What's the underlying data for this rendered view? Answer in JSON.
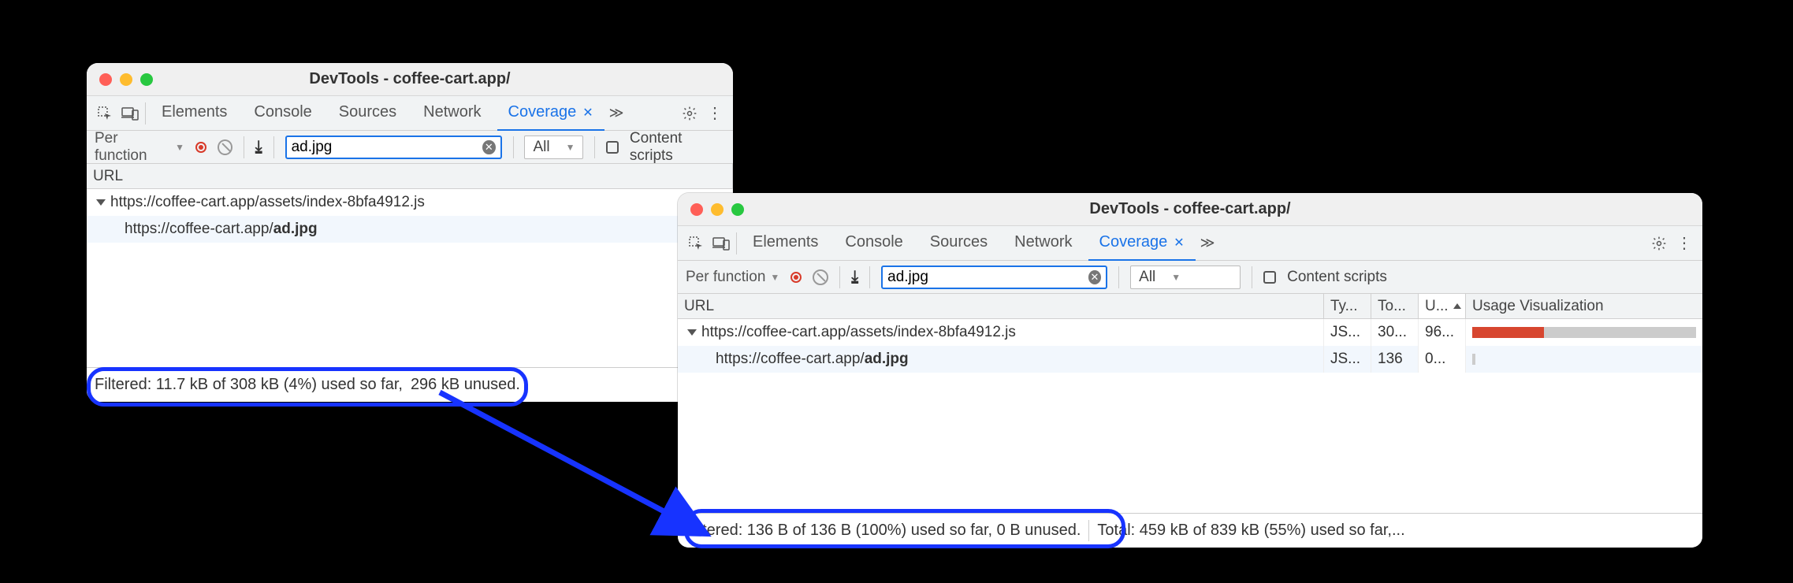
{
  "winLeft": {
    "title": "DevTools - coffee-cart.app/",
    "tabs": {
      "elements": "Elements",
      "console": "Console",
      "sources": "Sources",
      "network": "Network",
      "coverage": "Coverage"
    },
    "toolbar": {
      "perFunction": "Per function",
      "filterValue": "ad.jpg",
      "all": "All",
      "contentScripts": "Content scripts"
    },
    "header": {
      "url": "URL"
    },
    "rows": [
      {
        "url_prefix": "https://coffee-cart.app/assets/index-8bfa4912.js",
        "url_bold": ""
      },
      {
        "url_prefix": "https://coffee-cart.app/",
        "url_bold": "ad.jpg"
      }
    ],
    "status": {
      "filtered": "Filtered: 11.7 kB of 308 kB (4%) used so far,",
      "unused": "296 kB unused."
    }
  },
  "winRight": {
    "title": "DevTools - coffee-cart.app/",
    "tabs": {
      "elements": "Elements",
      "console": "Console",
      "sources": "Sources",
      "network": "Network",
      "coverage": "Coverage"
    },
    "toolbar": {
      "perFunction": "Per function",
      "filterValue": "ad.jpg",
      "all": "All",
      "contentScripts": "Content scripts"
    },
    "header": {
      "url": "URL",
      "type": "Ty...",
      "total": "To...",
      "unused": "U...",
      "viz": "Usage Visualization"
    },
    "rows": [
      {
        "url_prefix": "https://coffee-cart.app/assets/index-8bfa4912.js",
        "url_bold": "",
        "type": "JS...",
        "total": "30...",
        "unused": "96...",
        "usedPct": 32
      },
      {
        "url_prefix": "https://coffee-cart.app/",
        "url_bold": "ad.jpg",
        "type": "JS...",
        "total": "136",
        "unused": "0...",
        "usedPct": 0
      }
    ],
    "status": {
      "filtered": "Filtered: 136 B of 136 B (100%) used so far, 0 B unused.",
      "total": "Total: 459 kB of 839 kB (55%) used so far,..."
    }
  }
}
